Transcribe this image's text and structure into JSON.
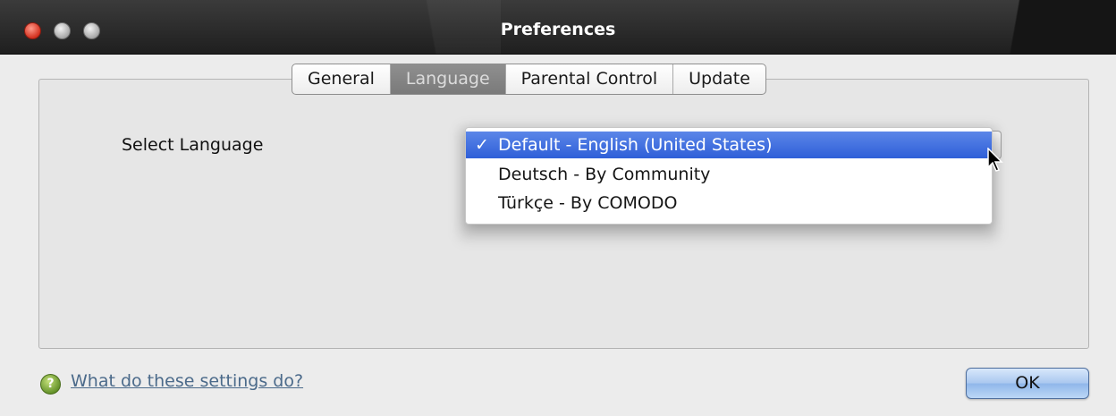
{
  "window": {
    "title": "Preferences"
  },
  "tabs": [
    {
      "label": "General",
      "active": false
    },
    {
      "label": "Language",
      "active": true
    },
    {
      "label": "Parental Control",
      "active": false
    },
    {
      "label": "Update",
      "active": false
    }
  ],
  "language": {
    "label": "Select Language",
    "options": [
      {
        "label": "Default - English (United States)",
        "selected": true,
        "check": "✓"
      },
      {
        "label": "Deutsch - By Community",
        "selected": false
      },
      {
        "label": "Türkçe - By COMODO",
        "selected": false
      }
    ]
  },
  "footer": {
    "help_link": "What do these settings do?",
    "help_icon_glyph": "?",
    "ok_label": "OK"
  },
  "colors": {
    "selection": "#2f5fd8",
    "link": "#4b6a8a",
    "close_button": "#d3311f"
  }
}
